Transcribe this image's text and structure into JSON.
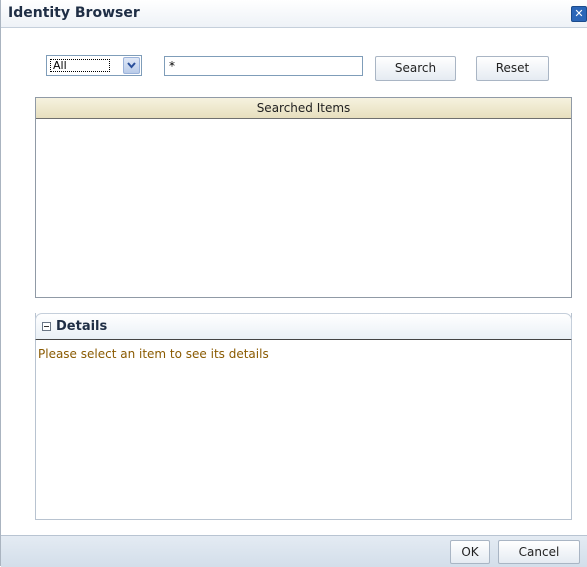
{
  "dialog": {
    "title": "Identity Browser",
    "close_icon": "close-icon"
  },
  "search": {
    "type_select_value": "All",
    "query_value": "*",
    "search_label": "Search",
    "reset_label": "Reset"
  },
  "results": {
    "header": "Searched Items",
    "rows": []
  },
  "details": {
    "title": "Details",
    "collapse_icon": "collapse-icon",
    "message": "Please select an item to see its details"
  },
  "footer": {
    "ok_label": "OK",
    "cancel_label": "Cancel"
  },
  "colors": {
    "details_message": "#8a5a00",
    "close_button": "#2b66b8"
  }
}
